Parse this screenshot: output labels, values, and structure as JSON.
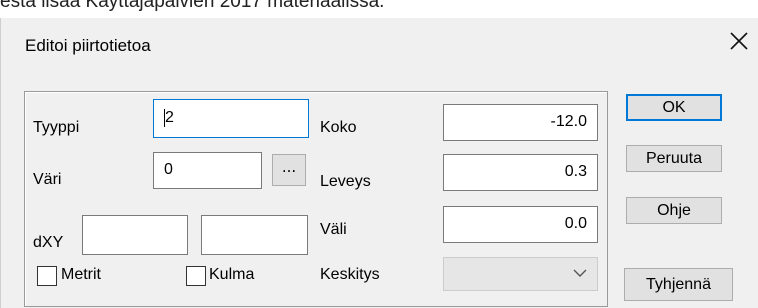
{
  "page_caption": "esta lisää Käyttäjäpäivien 2017 materiaalissa.",
  "dialog": {
    "title": "Editoi piirtotietoa",
    "close_icon": "close-icon"
  },
  "fields": {
    "tyyppi": {
      "label": "Tyyppi",
      "value": "2"
    },
    "vari": {
      "label": "Väri",
      "value": "0",
      "browse_label": "..."
    },
    "dxy": {
      "label": "dXY",
      "x_value": "",
      "y_value": ""
    },
    "koko": {
      "label": "Koko",
      "value": "-12.0"
    },
    "leveys": {
      "label": "Leveys",
      "value": "0.3"
    },
    "vali": {
      "label": "Väli",
      "value": "0.0"
    },
    "keskitys": {
      "label": "Keskitys",
      "value": "",
      "icon": "chevron-down-icon"
    }
  },
  "checkboxes": {
    "metrit": {
      "label": "Metrit",
      "checked": false
    },
    "kulma": {
      "label": "Kulma",
      "checked": false
    }
  },
  "buttons": {
    "ok": "OK",
    "peruuta": "Peruuta",
    "ohje": "Ohje",
    "tyhjenna": "Tyhjennä"
  },
  "colors": {
    "dialog_bg": "#f0f0f0",
    "focus_accent": "#0078d7",
    "button_bg": "#e1e1e1"
  }
}
